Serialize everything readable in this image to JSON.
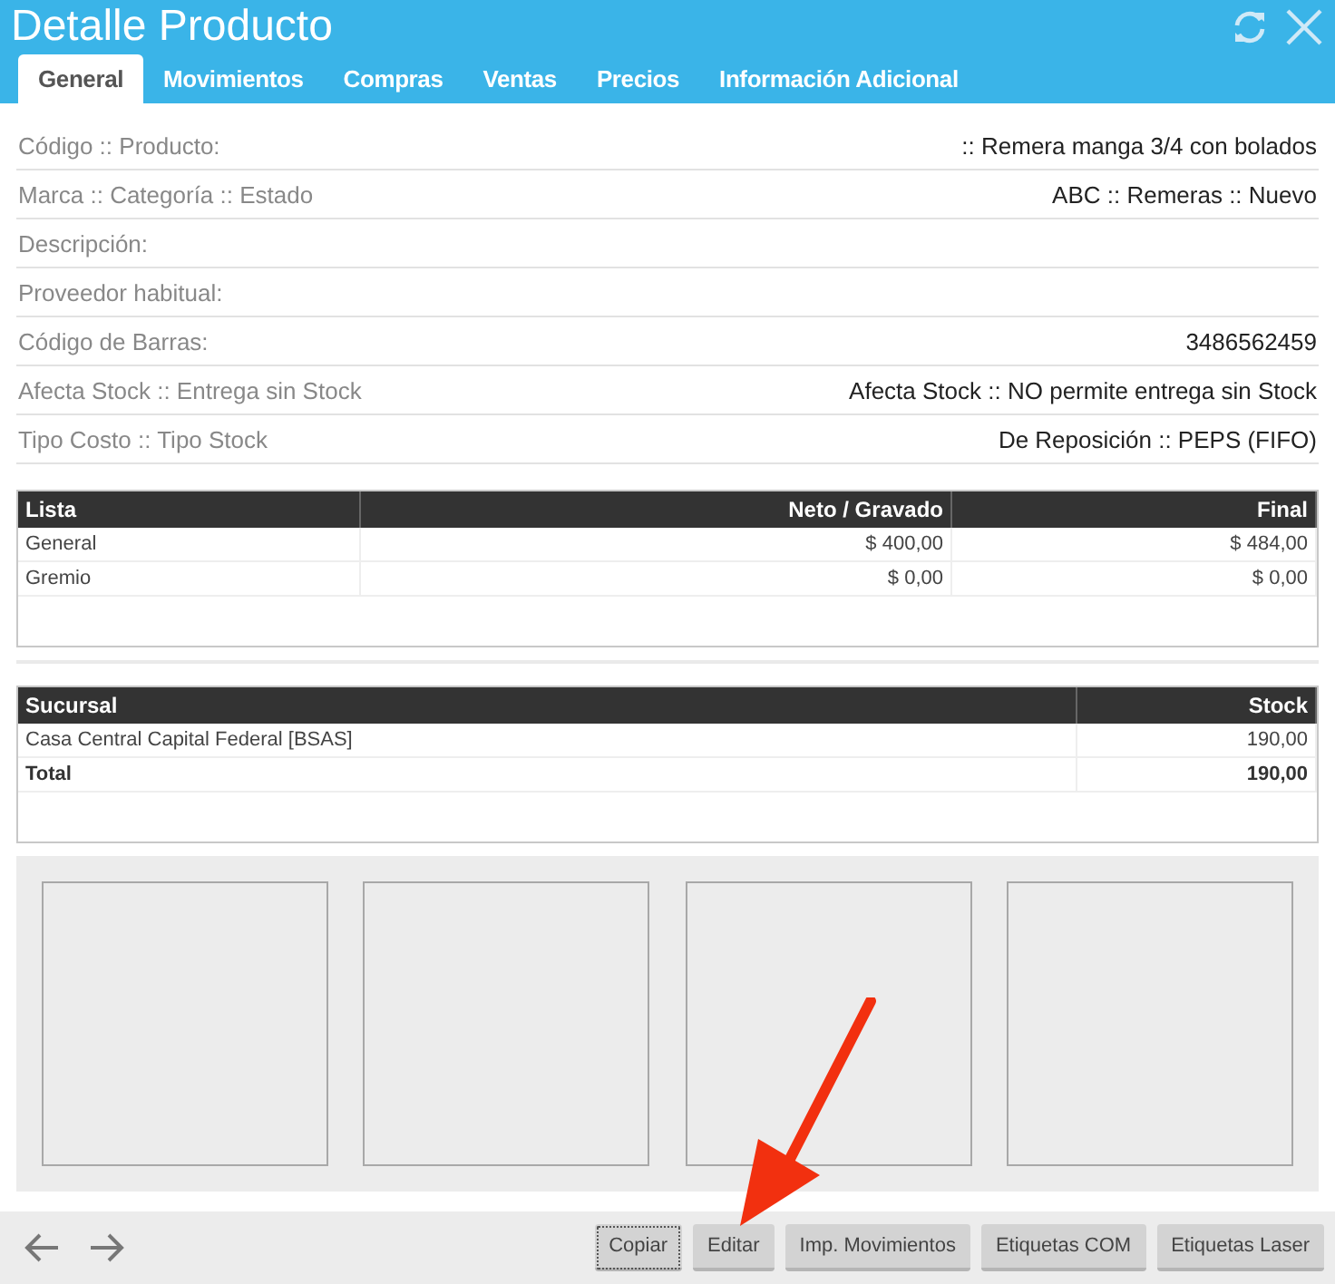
{
  "window": {
    "title": "Detalle Producto"
  },
  "tabs": [
    {
      "label": "General",
      "selected": true
    },
    {
      "label": "Movimientos",
      "selected": false
    },
    {
      "label": "Compras",
      "selected": false
    },
    {
      "label": "Ventas",
      "selected": false
    },
    {
      "label": "Precios",
      "selected": false
    },
    {
      "label": "Información Adicional",
      "selected": false
    }
  ],
  "fields": [
    {
      "label": "Código :: Producto:",
      "value": ":: Remera manga 3/4 con bolados"
    },
    {
      "label": "Marca :: Categoría :: Estado",
      "value": "ABC :: Remeras :: Nuevo"
    },
    {
      "label": "Descripción:"
    },
    {
      "label": "Proveedor habitual:"
    },
    {
      "label": "Código de Barras:",
      "value": "3486562459"
    },
    {
      "label": "Afecta Stock :: Entrega sin Stock",
      "value": "Afecta Stock :: NO permite entrega sin Stock"
    },
    {
      "label": "Tipo Costo :: Tipo Stock",
      "value": "De Reposición :: PEPS (FIFO)"
    }
  ],
  "price_table": {
    "columns": [
      "Lista",
      "Neto / Gravado",
      "Final"
    ],
    "rows": [
      {
        "cells": [
          "General",
          "$ 400,00",
          "$ 484,00"
        ]
      },
      {
        "cells": [
          "Gremio",
          "$ 0,00",
          "$ 0,00"
        ]
      }
    ]
  },
  "stock_table": {
    "columns": [
      "Sucursal",
      "Stock"
    ],
    "rows": [
      {
        "cells": [
          "Casa Central Capital Federal [BSAS]",
          "190,00"
        ],
        "total": false
      },
      {
        "cells": [
          "Total",
          "190,00"
        ],
        "total": true
      }
    ]
  },
  "image_slots": [
    {
      "kind": "empty"
    },
    {
      "kind": "empty"
    },
    {
      "kind": "empty"
    },
    {
      "kind": "empty"
    }
  ],
  "buttons": [
    {
      "label": "Copiar",
      "focused": true
    },
    {
      "label": "Editar",
      "focused": false
    },
    {
      "label": "Imp. Movimientos",
      "focused": false
    },
    {
      "label": "Etiquetas COM",
      "focused": false
    },
    {
      "label": "Etiquetas Laser",
      "focused": false
    }
  ]
}
